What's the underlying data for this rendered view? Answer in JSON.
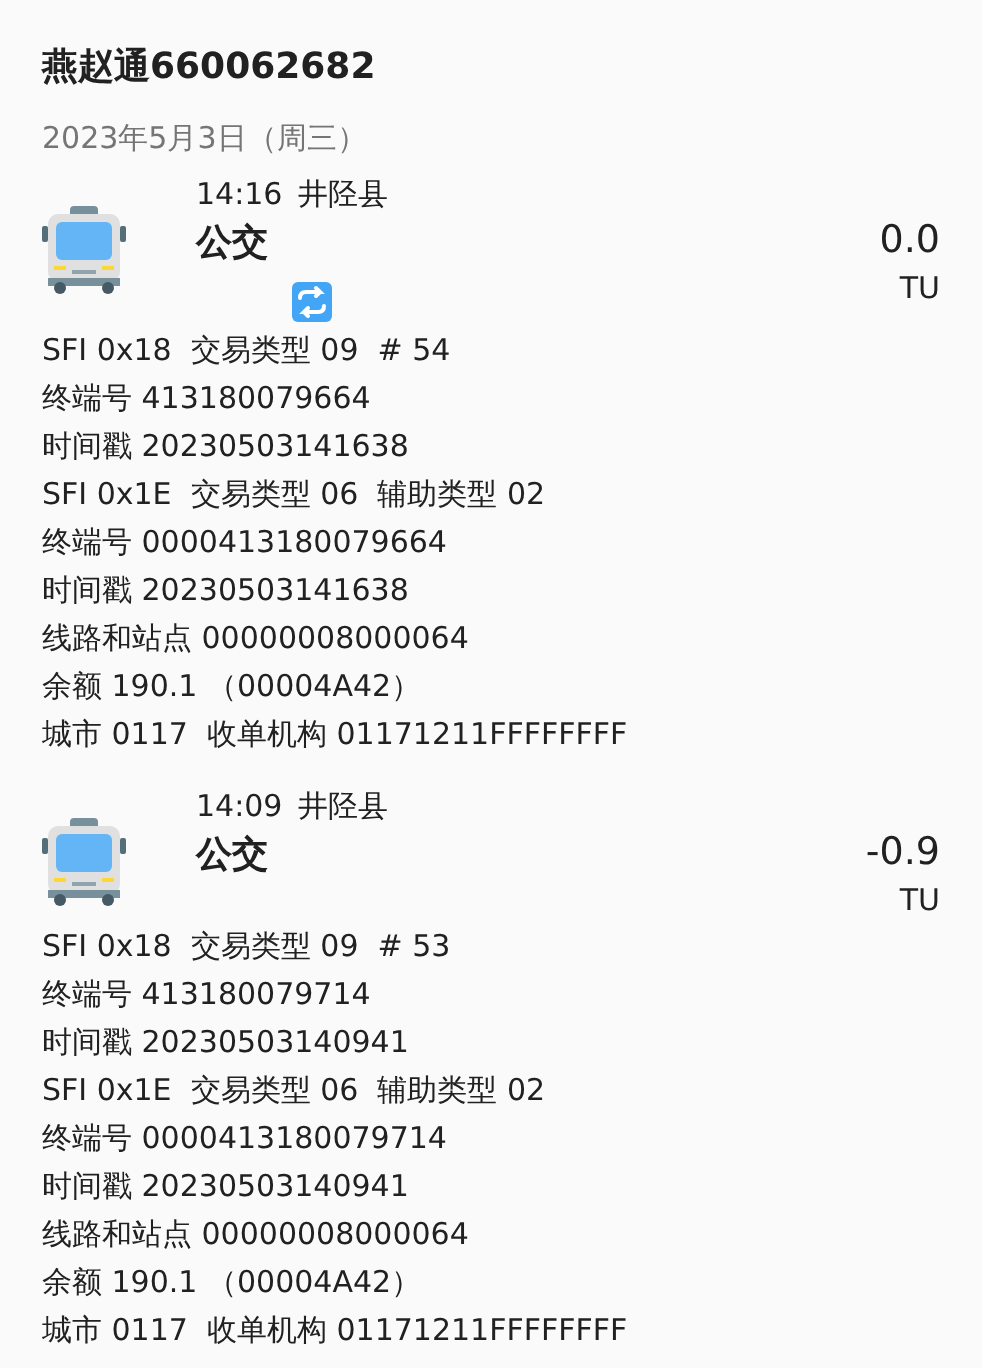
{
  "card_title": "燕赵通660062682",
  "date": "2023年5月3日（周三）",
  "trips": [
    {
      "time": "14:16",
      "place": "井陉县",
      "mode": "公交",
      "amount": "0.0",
      "unit": "TU",
      "transfer": true,
      "details": [
        "SFI 0x18  交易类型 09  # 54",
        "终端号 413180079664",
        "时间戳 20230503141638",
        "SFI 0x1E  交易类型 06  辅助类型 02",
        "终端号 0000413180079664",
        "时间戳 20230503141638",
        "线路和站点 00000008000064",
        "余额 190.1 （00004A42）",
        "城市 0117  收单机构 01171211FFFFFFFF"
      ]
    },
    {
      "time": "14:09",
      "place": "井陉县",
      "mode": "公交",
      "amount": "-0.9",
      "unit": "TU",
      "transfer": false,
      "details": [
        "SFI 0x18  交易类型 09  # 53",
        "终端号 413180079714",
        "时间戳 20230503140941",
        "SFI 0x1E  交易类型 06  辅助类型 02",
        "终端号 0000413180079714",
        "时间戳 20230503140941",
        "线路和站点 00000008000064",
        "余额 190.1 （00004A42）",
        "城市 0117  收单机构 01171211FFFFFFFF"
      ]
    }
  ]
}
